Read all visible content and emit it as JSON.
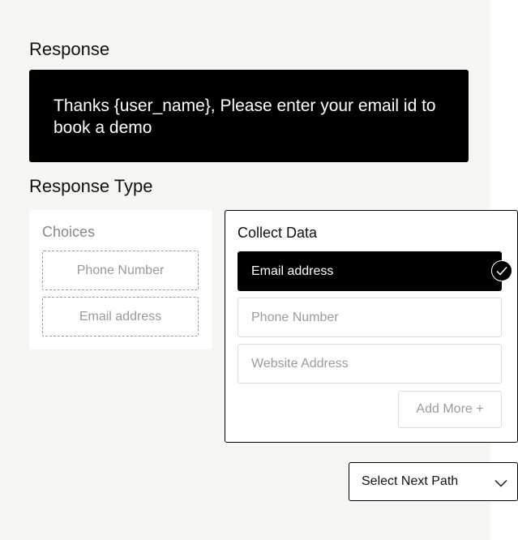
{
  "response": {
    "title": "Response",
    "message": "Thanks {user_name}, Please enter your email id to book a demo"
  },
  "response_type": {
    "title": "Response Type",
    "choices": {
      "title": "Choices",
      "items": [
        {
          "label": "Phone Number"
        },
        {
          "label": "Email address"
        }
      ]
    },
    "collect_data": {
      "title": "Collect Data",
      "fields": [
        {
          "label": "Email address",
          "selected": true
        },
        {
          "label": "Phone Number",
          "selected": false
        },
        {
          "label": "Website Address",
          "selected": false
        }
      ],
      "add_more_label": "Add More +"
    }
  },
  "next_path": {
    "label": "Select Next Path",
    "icon": "chevron-down-icon"
  },
  "colors": {
    "panel_background": "#f8f6f2",
    "primary": "#000000",
    "muted_text": "#9c9c9c"
  }
}
